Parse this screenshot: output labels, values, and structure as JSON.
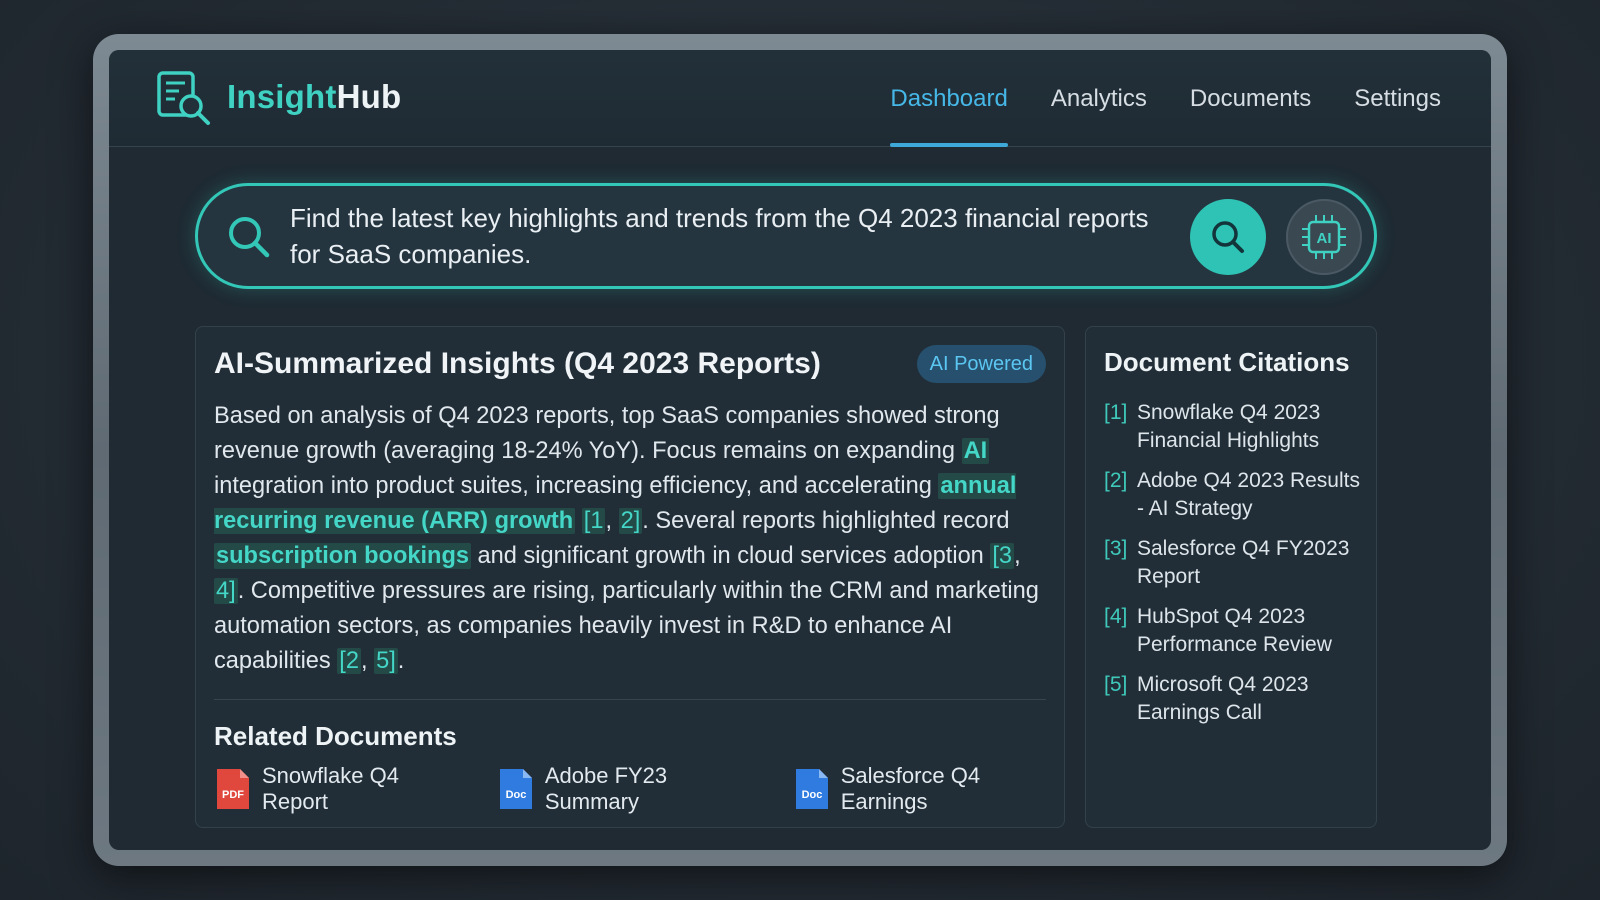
{
  "brand": {
    "part1": "Insight",
    "part2": "Hub"
  },
  "nav": [
    {
      "label": "Dashboard",
      "active": true
    },
    {
      "label": "Analytics",
      "active": false
    },
    {
      "label": "Documents",
      "active": false
    },
    {
      "label": "Settings",
      "active": false
    }
  ],
  "search": {
    "value": "Find the latest key highlights and trends from the Q4 2023 financial reports for SaaS companies.",
    "ai_label": "AI"
  },
  "insights": {
    "title": "AI-Summarized Insights (Q4 2023 Reports)",
    "badge": "AI Powered",
    "summary": {
      "t1": "Based on analysis of Q4 2023 reports, top SaaS companies showed strong revenue growth (averaging 18-24% YoY). Focus remains on expanding ",
      "h1": "AI",
      "t2": " integration into product suites, increasing efficiency, and accelerating ",
      "h2": "annual recurring revenue (ARR) growth",
      "c1": "[1",
      "c2": "2]",
      "t3": ". Several reports highlighted record ",
      "h3": "subscription bookings",
      "t4": " and significant growth in cloud services adoption ",
      "c3": "[3",
      "c4": "4]",
      "t5": ". Competitive pressures are rising, particularly within the CRM and marketing automation sectors, as companies heavily invest in R&D to enhance AI capabilities ",
      "c5": "[2",
      "c6": "5]",
      "t6": "."
    },
    "related_title": "Related Documents",
    "related": [
      {
        "name": "Snowflake Q4 Report",
        "type": "PDF",
        "color": "#e0473d"
      },
      {
        "name": "Adobe FY23 Summary",
        "type": "Doc",
        "color": "#2f7be0"
      },
      {
        "name": "Salesforce Q4 Earnings",
        "type": "Doc",
        "color": "#2f7be0"
      }
    ]
  },
  "citations": {
    "title": "Document Citations",
    "items": [
      {
        "num": "[1]",
        "text": "Snowflake Q4 2023 Financial Highlights"
      },
      {
        "num": "[2]",
        "text": "Adobe Q4 2023 Results - AI Strategy"
      },
      {
        "num": "[3]",
        "text": "Salesforce Q4 FY2023 Report"
      },
      {
        "num": "[4]",
        "text": "HubSpot Q4 2023 Performance Review"
      },
      {
        "num": "[5]",
        "text": "Microsoft Q4 2023 Earnings Call"
      }
    ]
  },
  "colors": {
    "accent": "#33c7b7",
    "nav_active": "#46b8e8",
    "background": "#1f2a33"
  }
}
